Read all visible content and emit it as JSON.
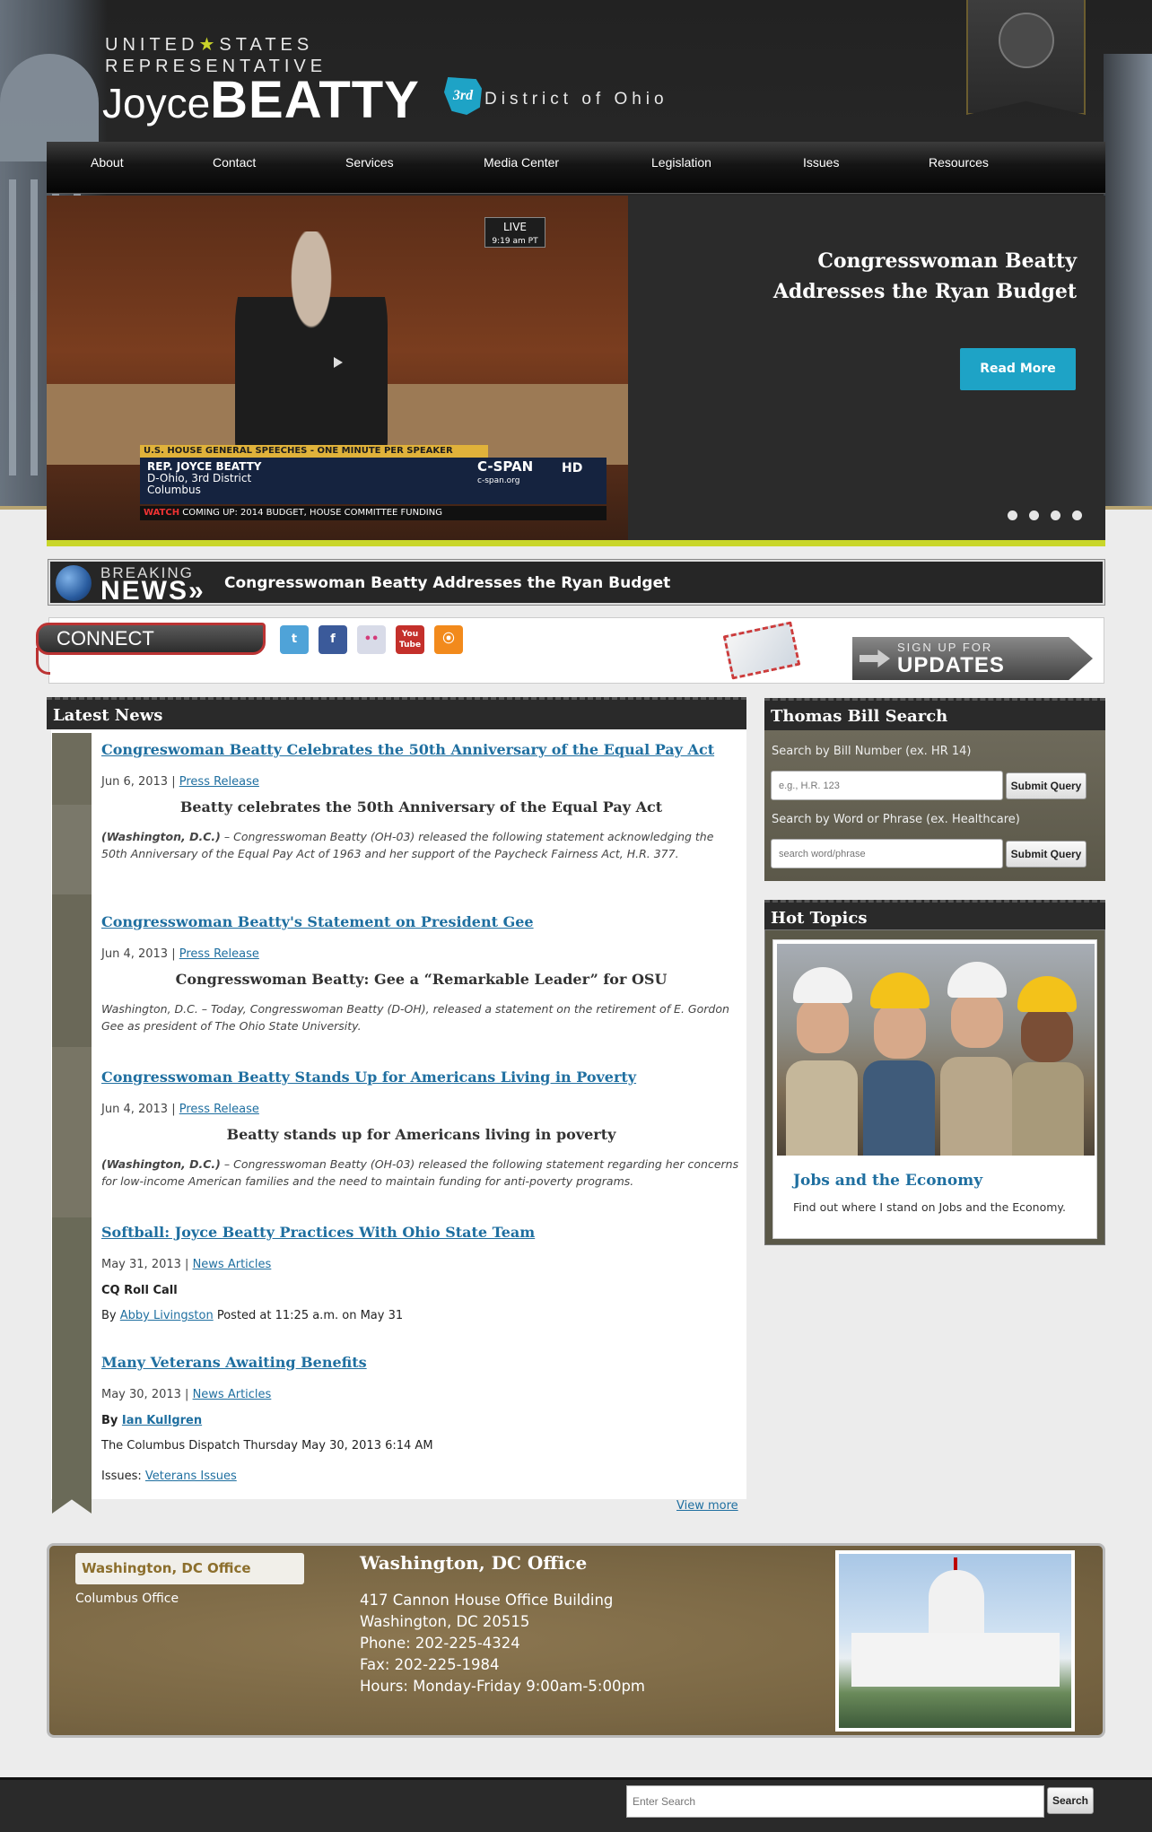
{
  "header": {
    "line1_a": "UNITED",
    "star": "★",
    "line1_b": "STATES",
    "line2": "REPRESENTATIVE",
    "first_name": "Joyce",
    "last_name": "BEATTY",
    "district_badge": "3rd",
    "district_text": "District of Ohio"
  },
  "nav": [
    {
      "label": "About"
    },
    {
      "label": "Contact"
    },
    {
      "label": "Services"
    },
    {
      "label": "Media Center"
    },
    {
      "label": "Legislation"
    },
    {
      "label": "Issues"
    },
    {
      "label": "Resources"
    }
  ],
  "slider": {
    "live": "LIVE",
    "live_time": "9:19 am PT",
    "chyron_top": "U.S. HOUSE  GENERAL SPEECHES - ONE MINUTE PER SPEAKER",
    "chyron_name": "REP. JOYCE BEATTY",
    "chyron_line2": "D-Ohio, 3rd District",
    "chyron_line3": "Columbus",
    "cspan": "C-SPAN",
    "cspan_url": "c-span.org",
    "hd": "HD",
    "watch_label": "WATCH",
    "watch_text": "COMING UP: 2014 BUDGET, HOUSE COMMITTEE FUNDING",
    "caption": "Congresswoman Beatty Addresses the Ryan Budget",
    "read_more": "Read More",
    "slide_count": 4
  },
  "breaking": {
    "word1": "BREAKING",
    "word2": "NEWS»",
    "headline": "Congresswoman Beatty Addresses the Ryan Budget"
  },
  "connect": {
    "label": "CONNECT",
    "social": [
      {
        "name": "twitter",
        "glyph": "t",
        "color": "#4fa3d8"
      },
      {
        "name": "facebook",
        "glyph": "f",
        "color": "#3b5a9a"
      },
      {
        "name": "flickr",
        "glyph": "••",
        "color": "#d8dbe8"
      },
      {
        "name": "youtube",
        "glyph": "You Tube",
        "color": "#c4302b"
      },
      {
        "name": "rss",
        "glyph": "⦿",
        "color": "#f28a1c"
      }
    ],
    "signup_small": "SIGN UP FOR",
    "signup_big": "UPDATES"
  },
  "latest_news": {
    "heading": "Latest News",
    "items": [
      {
        "title": "Congreswoman Beatty Celebrates the 50th Anniversary of the Equal Pay Act",
        "date": "Jun 6, 2013",
        "category": "Press Release",
        "subtitle": "Beatty celebrates the 50th Anniversary of the Equal Pay Act",
        "lead": "(Washington, D.C.)",
        "body": " – Congresswoman Beatty (OH-03) released the following statement acknowledging the 50th Anniversary of the Equal Pay Act of 1963 and her support of the Paycheck Fairness Act, H.R. 377."
      },
      {
        "title": "Congresswoman Beatty's Statement on President Gee",
        "date": "Jun 4, 2013",
        "category": "Press Release",
        "subtitle": "Congresswoman Beatty: Gee a “Remarkable Leader” for OSU",
        "body": "Washington, D.C. – Today, Congresswoman Beatty (D-OH), released a statement on the retirement of E. Gordon Gee as president of The Ohio State University."
      },
      {
        "title": "Congresswoman Beatty Stands Up for Americans Living in Poverty",
        "date": "Jun 4, 2013",
        "category": "Press Release",
        "subtitle": "Beatty stands up for Americans living in poverty",
        "lead": "(Washington, D.C.)",
        "body": " – Congresswoman Beatty (OH-03) released the following statement regarding her concerns for low-income American families and the need to maintain funding for anti-poverty programs."
      },
      {
        "title": "Softball: Joyce Beatty Practices With Ohio State Team",
        "date": "May 31, 2013",
        "category": "News Articles",
        "source": "CQ Roll Call",
        "by": "By",
        "author": "Abby Livingston",
        "posted": "Posted at 11:25 a.m. on May 31"
      },
      {
        "title": "Many Veterans Awaiting Benefits",
        "date": "May 30, 2013",
        "category": "News Articles",
        "by": "By",
        "author": "Ian Kullgren",
        "source_line": "The Columbus Dispatch Thursday May 30, 2013 6:14 AM",
        "issues_label": "Issues:",
        "issues_link": "Veterans Issues"
      }
    ],
    "separator": "|",
    "view_more": "View more"
  },
  "bill_search": {
    "heading": "Thomas Bill Search",
    "label1": "Search by Bill Number (ex. HR 14)",
    "placeholder1": "e.g., H.R. 123",
    "label2": "Search by Word or Phrase (ex. Healthcare)",
    "placeholder2": "search word/phrase",
    "button": "Submit Query"
  },
  "hot_topics": {
    "heading": "Hot Topics",
    "title": "Jobs and the Economy",
    "text": "Find out where I stand on Jobs and the Economy."
  },
  "office": {
    "tab_active": "Washington, DC Office",
    "tab_other": "Columbus Office",
    "title": "Washington, DC Office",
    "lines": [
      "417 Cannon House Office Building",
      "Washington, DC 20515",
      "Phone:  202-225-4324",
      "Fax:  202-225-1984",
      "Hours: Monday-Friday 9:00am-5:00pm"
    ]
  },
  "footer": {
    "search_placeholder": "Enter Search",
    "search_button": "Search"
  }
}
